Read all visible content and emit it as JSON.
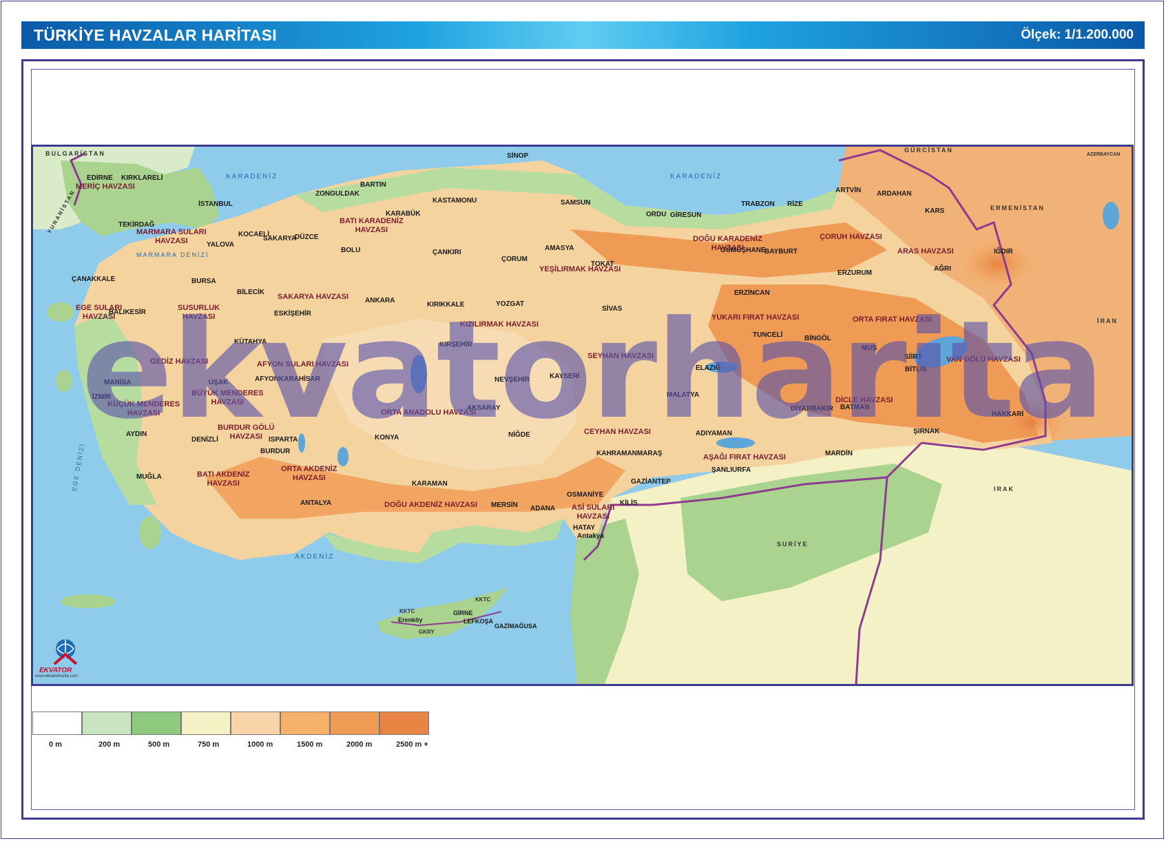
{
  "header": {
    "title": "TÜRKİYE HAVZALAR HARİTASI",
    "scale": "Ölçek: 1/1.200.000"
  },
  "watermark": "ekvatorharita",
  "logo": {
    "name": "EKVATOR",
    "url": "www.ekvatorharita.com"
  },
  "legend": {
    "items": [
      {
        "label": "0 m",
        "color": "#ffffff"
      },
      {
        "label": "200 m",
        "color": "#c9e5c0"
      },
      {
        "label": "500 m",
        "color": "#8fc97e"
      },
      {
        "label": "750 m",
        "color": "#f4f1c6"
      },
      {
        "label": "1000 m",
        "color": "#f9d4a8"
      },
      {
        "label": "1500 m",
        "color": "#f5b06a"
      },
      {
        "label": "2000 m",
        "color": "#ef9a55"
      },
      {
        "label": "2500 m +",
        "color": "#e88545"
      }
    ]
  },
  "colors": {
    "sea": "#8fcbea",
    "border": "#8e3a8f",
    "frame": "#3d3a8f",
    "lake": "#5fa6d8"
  },
  "seas": [
    {
      "name": "KARADENİZ"
    },
    {
      "name": "KARADENİZ"
    },
    {
      "name": "MARMARA DENİZİ"
    },
    {
      "name": "AKDENİZ"
    },
    {
      "name": "EGE DENİZİ"
    }
  ],
  "countries": [
    {
      "name": "BULGARİSTAN"
    },
    {
      "name": "YUNANİSTAN"
    },
    {
      "name": "GÜRCİSTAN"
    },
    {
      "name": "ERMENİSTAN"
    },
    {
      "name": "AZERBAYCAN"
    },
    {
      "name": "İRAN"
    },
    {
      "name": "IRAK"
    },
    {
      "name": "SURİYE"
    },
    {
      "name": "KKTC"
    },
    {
      "name": "KKTC"
    },
    {
      "name": "GKRY"
    }
  ],
  "basins": [
    {
      "name": "MERİÇ HAVZASI"
    },
    {
      "name": "MARMARA SULARI\nHAVZASI"
    },
    {
      "name": "SUSURLUK\nHAVZASI"
    },
    {
      "name": "EGE SULARI\nHAVZASI"
    },
    {
      "name": "SAKARYA HAVZASI"
    },
    {
      "name": "BATI KARADENİZ\nHAVZASI"
    },
    {
      "name": "GEDİZ HAVZASI"
    },
    {
      "name": "KÜÇÜK MENDERES\nHAVZASI"
    },
    {
      "name": "BÜYÜK MENDERES\nHAVZASI"
    },
    {
      "name": "AFYON SULARI HAVZASI"
    },
    {
      "name": "BURDUR GÖLÜ\nHAVZASI"
    },
    {
      "name": "BATI AKDENİZ\nHAVZASI"
    },
    {
      "name": "ORTA AKDENİZ\nHAVZASI"
    },
    {
      "name": "ORTA ANADOLU HAVZASI"
    },
    {
      "name": "KIZILIRMAK HAVZASI"
    },
    {
      "name": "YEŞİLIRMAK HAVZASI"
    },
    {
      "name": "DOĞU KARADENİZ\nHAVZASI"
    },
    {
      "name": "ÇORUH HAVZASI"
    },
    {
      "name": "ARAS HAVZASI"
    },
    {
      "name": "YUKARI FIRAT HAVZASI"
    },
    {
      "name": "ORTA FIRAT HAVZASI"
    },
    {
      "name": "VAN GÖLÜ HAVZASI"
    },
    {
      "name": "SEYHAN HAVZASI"
    },
    {
      "name": "CEYHAN HAVZASI"
    },
    {
      "name": "DİCLE HAVZASI"
    },
    {
      "name": "AŞAĞI FIRAT HAVZASI"
    },
    {
      "name": "DOĞU AKDENİZ HAVZASI"
    },
    {
      "name": "ASİ SULARI\nHAVZASI"
    }
  ],
  "cities": [
    {
      "name": "EDİRNE"
    },
    {
      "name": "KIRKLARELİ"
    },
    {
      "name": "TEKİRDAĞ"
    },
    {
      "name": "İSTANBUL"
    },
    {
      "name": "YALOVA"
    },
    {
      "name": "KOCAELİ"
    },
    {
      "name": "SAKARYA"
    },
    {
      "name": "DÜZCE"
    },
    {
      "name": "ZONGULDAK"
    },
    {
      "name": "BARTIN"
    },
    {
      "name": "KARABÜK"
    },
    {
      "name": "KASTAMONU"
    },
    {
      "name": "SİNOP"
    },
    {
      "name": "SAMSUN"
    },
    {
      "name": "ORDU"
    },
    {
      "name": "GİRESUN"
    },
    {
      "name": "TRABZON"
    },
    {
      "name": "RİZE"
    },
    {
      "name": "ARTVİN"
    },
    {
      "name": "ARDAHAN"
    },
    {
      "name": "KARS"
    },
    {
      "name": "IĞDIR"
    },
    {
      "name": "AĞRI"
    },
    {
      "name": "ERZURUM"
    },
    {
      "name": "BAYBURT"
    },
    {
      "name": "GÜMÜŞHANE"
    },
    {
      "name": "ERZİNCAN"
    },
    {
      "name": "TUNCELİ"
    },
    {
      "name": "BİNGÖL"
    },
    {
      "name": "MUŞ"
    },
    {
      "name": "BİTLİS"
    },
    {
      "name": "SİİRT"
    },
    {
      "name": "ŞIRNAK"
    },
    {
      "name": "HAKKARİ"
    },
    {
      "name": "BATMAN"
    },
    {
      "name": "DİYARBAKIR"
    },
    {
      "name": "MARDİN"
    },
    {
      "name": "ŞANLIURFA"
    },
    {
      "name": "ADIYAMAN"
    },
    {
      "name": "MALATYA"
    },
    {
      "name": "ELAZIĞ"
    },
    {
      "name": "SİVAS"
    },
    {
      "name": "TOKAT"
    },
    {
      "name": "AMASYA"
    },
    {
      "name": "ÇORUM"
    },
    {
      "name": "ÇANKIRI"
    },
    {
      "name": "YOZGAT"
    },
    {
      "name": "KIRIKKALE"
    },
    {
      "name": "ANKARA"
    },
    {
      "name": "KIRŞEHİR"
    },
    {
      "name": "NEVŞEHİR"
    },
    {
      "name": "KAYSERİ"
    },
    {
      "name": "AKSARAY"
    },
    {
      "name": "NİĞDE"
    },
    {
      "name": "KONYA"
    },
    {
      "name": "KARAMAN"
    },
    {
      "name": "MERSİN"
    },
    {
      "name": "ADANA"
    },
    {
      "name": "OSMANİYE"
    },
    {
      "name": "HATAY"
    },
    {
      "name": "Antakya"
    },
    {
      "name": "GAZİANTEP"
    },
    {
      "name": "KİLİS"
    },
    {
      "name": "KAHRAMANMARAŞ"
    },
    {
      "name": "BOLU"
    },
    {
      "name": "BİLECİK"
    },
    {
      "name": "ESKİŞEHİR"
    },
    {
      "name": "BURSA"
    },
    {
      "name": "BALIKESİR"
    },
    {
      "name": "ÇANAKKALE"
    },
    {
      "name": "KÜTAHYA"
    },
    {
      "name": "AFYONKARAHİSAR"
    },
    {
      "name": "UŞAK"
    },
    {
      "name": "MANİSA"
    },
    {
      "name": "İZMİR"
    },
    {
      "name": "AYDIN"
    },
    {
      "name": "DENİZLİ"
    },
    {
      "name": "MUĞLA"
    },
    {
      "name": "ISPARTA"
    },
    {
      "name": "BURDUR"
    },
    {
      "name": "ANTALYA"
    },
    {
      "name": "GİRNE"
    },
    {
      "name": "LEFKOŞA"
    },
    {
      "name": "GAZİMAĞUSA"
    },
    {
      "name": "Erenköy"
    }
  ]
}
